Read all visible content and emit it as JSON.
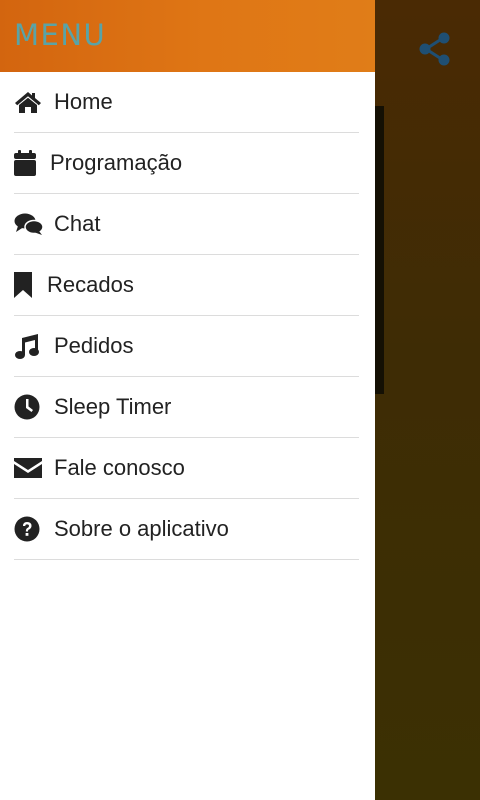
{
  "drawer": {
    "title": "MENU",
    "items": [
      {
        "label": "Home",
        "icon": "home-icon"
      },
      {
        "label": "Programação",
        "icon": "calendar-icon"
      },
      {
        "label": "Chat",
        "icon": "chat-icon"
      },
      {
        "label": "Recados",
        "icon": "bookmark-icon"
      },
      {
        "label": "Pedidos",
        "icon": "music-icon"
      },
      {
        "label": "Sleep Timer",
        "icon": "clock-icon"
      },
      {
        "label": "Fale conosco",
        "icon": "envelope-icon"
      },
      {
        "label": "Sobre o aplicativo",
        "icon": "question-icon"
      }
    ]
  },
  "background": {
    "share_icon": "share-icon"
  },
  "colors": {
    "header_orange": "#df7615",
    "title_teal": "#5aa3a6",
    "icon_dark": "#222222",
    "share_icon": "#1f4f73"
  }
}
